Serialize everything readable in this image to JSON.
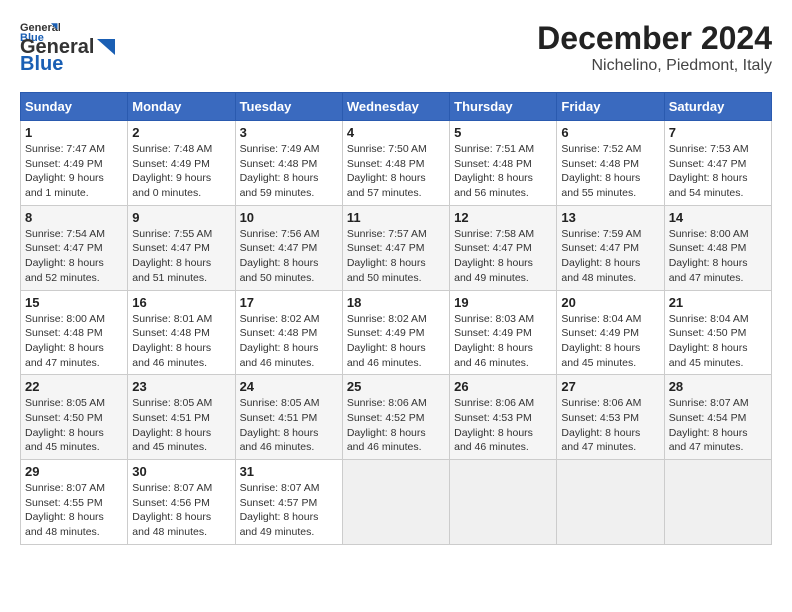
{
  "logo": {
    "line1": "General",
    "line2": "Blue"
  },
  "title": "December 2024",
  "subtitle": "Nichelino, Piedmont, Italy",
  "days_of_week": [
    "Sunday",
    "Monday",
    "Tuesday",
    "Wednesday",
    "Thursday",
    "Friday",
    "Saturday"
  ],
  "weeks": [
    [
      {
        "day": "1",
        "info": "Sunrise: 7:47 AM\nSunset: 4:49 PM\nDaylight: 9 hours\nand 1 minute."
      },
      {
        "day": "2",
        "info": "Sunrise: 7:48 AM\nSunset: 4:49 PM\nDaylight: 9 hours\nand 0 minutes."
      },
      {
        "day": "3",
        "info": "Sunrise: 7:49 AM\nSunset: 4:48 PM\nDaylight: 8 hours\nand 59 minutes."
      },
      {
        "day": "4",
        "info": "Sunrise: 7:50 AM\nSunset: 4:48 PM\nDaylight: 8 hours\nand 57 minutes."
      },
      {
        "day": "5",
        "info": "Sunrise: 7:51 AM\nSunset: 4:48 PM\nDaylight: 8 hours\nand 56 minutes."
      },
      {
        "day": "6",
        "info": "Sunrise: 7:52 AM\nSunset: 4:48 PM\nDaylight: 8 hours\nand 55 minutes."
      },
      {
        "day": "7",
        "info": "Sunrise: 7:53 AM\nSunset: 4:47 PM\nDaylight: 8 hours\nand 54 minutes."
      }
    ],
    [
      {
        "day": "8",
        "info": "Sunrise: 7:54 AM\nSunset: 4:47 PM\nDaylight: 8 hours\nand 52 minutes."
      },
      {
        "day": "9",
        "info": "Sunrise: 7:55 AM\nSunset: 4:47 PM\nDaylight: 8 hours\nand 51 minutes."
      },
      {
        "day": "10",
        "info": "Sunrise: 7:56 AM\nSunset: 4:47 PM\nDaylight: 8 hours\nand 50 minutes."
      },
      {
        "day": "11",
        "info": "Sunrise: 7:57 AM\nSunset: 4:47 PM\nDaylight: 8 hours\nand 50 minutes."
      },
      {
        "day": "12",
        "info": "Sunrise: 7:58 AM\nSunset: 4:47 PM\nDaylight: 8 hours\nand 49 minutes."
      },
      {
        "day": "13",
        "info": "Sunrise: 7:59 AM\nSunset: 4:47 PM\nDaylight: 8 hours\nand 48 minutes."
      },
      {
        "day": "14",
        "info": "Sunrise: 8:00 AM\nSunset: 4:48 PM\nDaylight: 8 hours\nand 47 minutes."
      }
    ],
    [
      {
        "day": "15",
        "info": "Sunrise: 8:00 AM\nSunset: 4:48 PM\nDaylight: 8 hours\nand 47 minutes."
      },
      {
        "day": "16",
        "info": "Sunrise: 8:01 AM\nSunset: 4:48 PM\nDaylight: 8 hours\nand 46 minutes."
      },
      {
        "day": "17",
        "info": "Sunrise: 8:02 AM\nSunset: 4:48 PM\nDaylight: 8 hours\nand 46 minutes."
      },
      {
        "day": "18",
        "info": "Sunrise: 8:02 AM\nSunset: 4:49 PM\nDaylight: 8 hours\nand 46 minutes."
      },
      {
        "day": "19",
        "info": "Sunrise: 8:03 AM\nSunset: 4:49 PM\nDaylight: 8 hours\nand 46 minutes."
      },
      {
        "day": "20",
        "info": "Sunrise: 8:04 AM\nSunset: 4:49 PM\nDaylight: 8 hours\nand 45 minutes."
      },
      {
        "day": "21",
        "info": "Sunrise: 8:04 AM\nSunset: 4:50 PM\nDaylight: 8 hours\nand 45 minutes."
      }
    ],
    [
      {
        "day": "22",
        "info": "Sunrise: 8:05 AM\nSunset: 4:50 PM\nDaylight: 8 hours\nand 45 minutes."
      },
      {
        "day": "23",
        "info": "Sunrise: 8:05 AM\nSunset: 4:51 PM\nDaylight: 8 hours\nand 45 minutes."
      },
      {
        "day": "24",
        "info": "Sunrise: 8:05 AM\nSunset: 4:51 PM\nDaylight: 8 hours\nand 46 minutes."
      },
      {
        "day": "25",
        "info": "Sunrise: 8:06 AM\nSunset: 4:52 PM\nDaylight: 8 hours\nand 46 minutes."
      },
      {
        "day": "26",
        "info": "Sunrise: 8:06 AM\nSunset: 4:53 PM\nDaylight: 8 hours\nand 46 minutes."
      },
      {
        "day": "27",
        "info": "Sunrise: 8:06 AM\nSunset: 4:53 PM\nDaylight: 8 hours\nand 47 minutes."
      },
      {
        "day": "28",
        "info": "Sunrise: 8:07 AM\nSunset: 4:54 PM\nDaylight: 8 hours\nand 47 minutes."
      }
    ],
    [
      {
        "day": "29",
        "info": "Sunrise: 8:07 AM\nSunset: 4:55 PM\nDaylight: 8 hours\nand 48 minutes."
      },
      {
        "day": "30",
        "info": "Sunrise: 8:07 AM\nSunset: 4:56 PM\nDaylight: 8 hours\nand 48 minutes."
      },
      {
        "day": "31",
        "info": "Sunrise: 8:07 AM\nSunset: 4:57 PM\nDaylight: 8 hours\nand 49 minutes."
      },
      {
        "day": "",
        "info": ""
      },
      {
        "day": "",
        "info": ""
      },
      {
        "day": "",
        "info": ""
      },
      {
        "day": "",
        "info": ""
      }
    ]
  ]
}
